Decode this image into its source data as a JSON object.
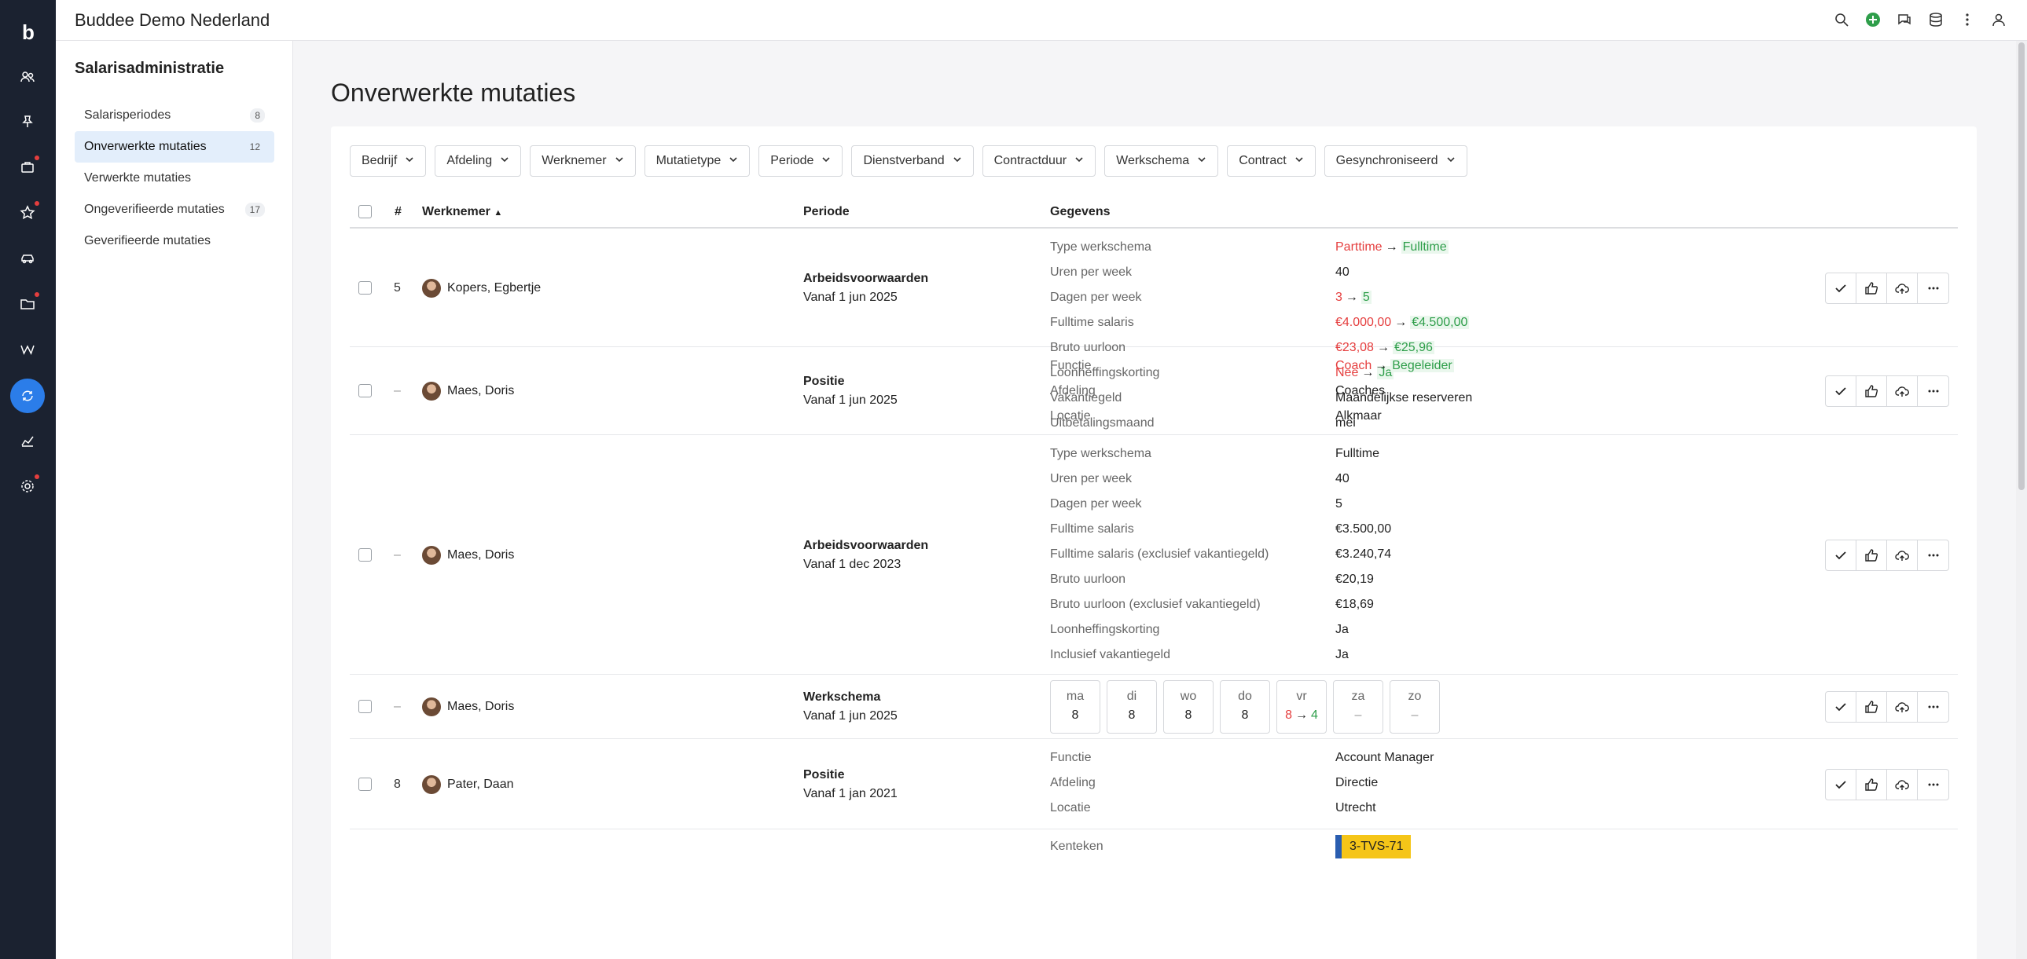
{
  "app": {
    "company": "Buddee Demo Nederland",
    "logo": "b"
  },
  "rail": {
    "icons": [
      "people-icon",
      "pin-icon",
      "briefcase-icon",
      "star-icon",
      "car-icon",
      "folder-icon",
      "wiki-icon",
      "payroll-icon",
      "chart-icon",
      "settings-icon"
    ]
  },
  "topbar": {
    "icons": [
      "search-icon",
      "add-icon",
      "chat-icon",
      "database-icon",
      "more-vertical-icon",
      "user-icon"
    ]
  },
  "sidebar": {
    "title": "Salarisadministratie",
    "items": [
      {
        "label": "Salarisperiodes",
        "count": "8"
      },
      {
        "label": "Onverwerkte mutaties",
        "count": "12"
      },
      {
        "label": "Verwerkte mutaties",
        "count": ""
      },
      {
        "label": "Ongeverifieerde mutaties",
        "count": "17"
      },
      {
        "label": "Geverifieerde mutaties",
        "count": ""
      }
    ]
  },
  "page": {
    "title": "Onverwerkte mutaties"
  },
  "filters": [
    "Bedrijf",
    "Afdeling",
    "Werknemer",
    "Mutatietype",
    "Periode",
    "Dienstverband",
    "Contractduur",
    "Werkschema",
    "Contract",
    "Gesynchroniseerd"
  ],
  "table": {
    "headers": {
      "num": "#",
      "employee": "Werknemer",
      "period": "Periode",
      "data": "Gegevens"
    },
    "rows": [
      {
        "num": "5",
        "employee": "Kopers, Egbertje",
        "type": "Arbeidsvoorwaarden",
        "from": "Vanaf 1 jun 2025",
        "fields": [
          {
            "label": "Type werkschema",
            "old": "Parttime",
            "new": "Fulltime"
          },
          {
            "label": "Uren per week",
            "value": "40"
          },
          {
            "label": "Dagen per week",
            "old": "3",
            "new": "5"
          },
          {
            "label": "Fulltime salaris",
            "old": "€4.000,00",
            "new": "€4.500,00"
          },
          {
            "label": "Bruto uurloon",
            "old": "€23,08",
            "new": "€25,96"
          },
          {
            "label": "Loonheffingskorting",
            "old": "Nee",
            "new": "Ja"
          },
          {
            "label": "Vakantiegeld",
            "value": "Maandelijkse reserveren"
          },
          {
            "label": "Uitbetalingsmaand",
            "value": "mei"
          }
        ]
      },
      {
        "num": "–",
        "employee": "Maes, Doris",
        "type": "Positie",
        "from": "Vanaf 1 jun 2025",
        "fields": [
          {
            "label": "Functie",
            "old": "Coach",
            "new": "Begeleider"
          },
          {
            "label": "Afdeling",
            "value": "Coaches"
          },
          {
            "label": "Locatie",
            "value": "Alkmaar"
          }
        ]
      },
      {
        "num": "–",
        "employee": "Maes, Doris",
        "type": "Arbeidsvoorwaarden",
        "from": "Vanaf 1 dec 2023",
        "fields": [
          {
            "label": "Type werkschema",
            "value": "Fulltime"
          },
          {
            "label": "Uren per week",
            "value": "40"
          },
          {
            "label": "Dagen per week",
            "value": "5"
          },
          {
            "label": "Fulltime salaris",
            "value": "€3.500,00"
          },
          {
            "label": "Fulltime salaris (exclusief vakantiegeld)",
            "value": "€3.240,74"
          },
          {
            "label": "Bruto uurloon",
            "value": "€20,19"
          },
          {
            "label": "Bruto uurloon (exclusief vakantiegeld)",
            "value": "€18,69"
          },
          {
            "label": "Loonheffingskorting",
            "value": "Ja"
          },
          {
            "label": "Inclusief vakantiegeld",
            "value": "Ja"
          }
        ]
      },
      {
        "num": "–",
        "employee": "Maes, Doris",
        "type": "Werkschema",
        "from": "Vanaf 1 jun 2025",
        "days": [
          {
            "name": "ma",
            "value": "8"
          },
          {
            "name": "di",
            "value": "8"
          },
          {
            "name": "wo",
            "value": "8"
          },
          {
            "name": "do",
            "value": "8"
          },
          {
            "name": "vr",
            "old": "8",
            "new": "4"
          },
          {
            "name": "za",
            "value": "–"
          },
          {
            "name": "zo",
            "value": "–"
          }
        ]
      },
      {
        "num": "8",
        "employee": "Pater, Daan",
        "type": "Positie",
        "from": "Vanaf 1 jan 2021",
        "fields": [
          {
            "label": "Functie",
            "value": "Account Manager"
          },
          {
            "label": "Afdeling",
            "value": "Directie"
          },
          {
            "label": "Locatie",
            "value": "Utrecht"
          }
        ]
      },
      {
        "num": "",
        "employee": "",
        "type": "",
        "from": "",
        "fields": [
          {
            "label": "Kenteken",
            "plate": "3-TVS-71"
          }
        ]
      }
    ]
  },
  "colors": {
    "rail": "#1b2230",
    "accent": "#2b7de9",
    "old": "#e53e3e",
    "new": "#2e9e4a",
    "plate": "#f5c518"
  }
}
